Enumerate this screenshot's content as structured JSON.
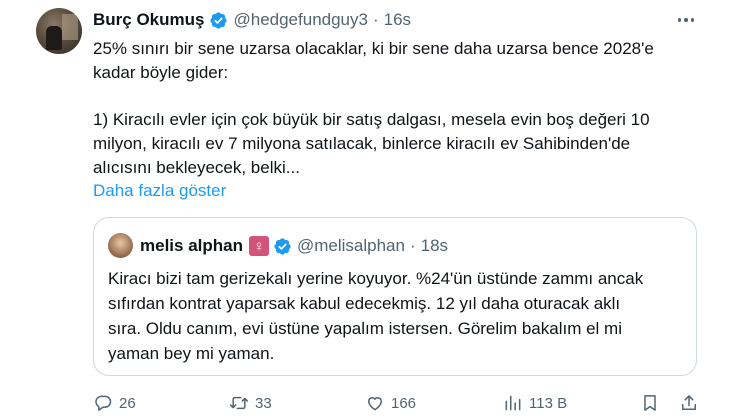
{
  "tweet": {
    "author_name": "Burç Okumuş",
    "author_handle": "@hedgefundguy3",
    "separator": "·",
    "time": "16s",
    "text_lines_1": [
      "25% sınırı bir sene uzarsa olacaklar, ki bir sene daha uzarsa bence 2028'e",
      "kadar böyle gider:"
    ],
    "text_lines_2": [
      "1) Kiracılı evler için çok büyük bir satış dalgası, mesela evin boş değeri 10",
      "milyon, kiracılı ev 7 milyona satılacak, binlerce kiracılı ev Sahibinden'de",
      "alıcısını bekleyecek, belki..."
    ],
    "show_more": "Daha fazla göster",
    "icons": {
      "verified": "verified-badge-icon",
      "more": "more-options-icon"
    },
    "colors": {
      "link": "#1d9bf0",
      "verified": "#1d9bf0",
      "muted": "#536471"
    }
  },
  "quoted": {
    "author_name": "melis alphan",
    "emoji": "♀",
    "author_handle": "@melisalphan",
    "separator": "·",
    "time": "18s",
    "text_lines": [
      "Kiracı bizi tam gerizekalı yerine koyuyor. %24'ün üstünde zammı ancak",
      "sıfırdan kontrat yaparsak kabul edecekmiş. 12 yıl daha oturacak aklı",
      "sıra. Oldu canım, evi üstüne yapalım istersen. Görelim bakalım el mi",
      "yaman bey mi yaman."
    ]
  },
  "actions": {
    "reply_count": "26",
    "retweet_count": "33",
    "like_count": "166",
    "views_count": "113 B",
    "icons": [
      "reply-icon",
      "retweet-icon",
      "like-icon",
      "views-icon",
      "bookmark-icon",
      "share-icon"
    ]
  }
}
